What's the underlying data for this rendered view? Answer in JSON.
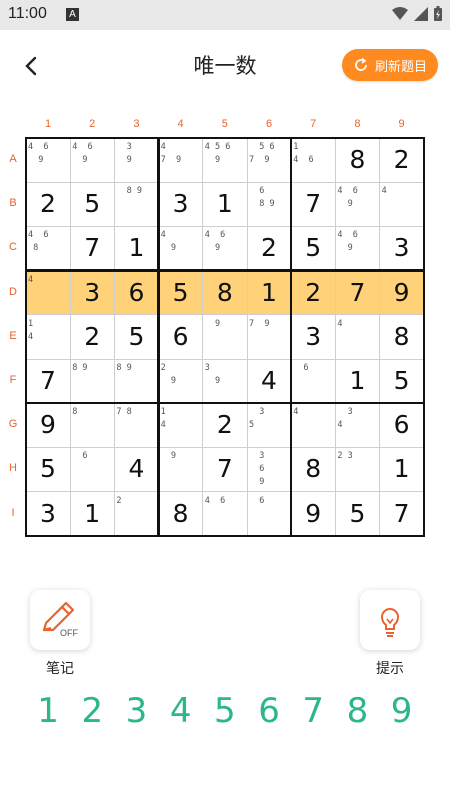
{
  "status_bar": {
    "time": "11:00",
    "notification_icon": "A"
  },
  "header": {
    "title": "唯一数",
    "refresh_label": "刷新题目"
  },
  "column_labels": [
    "1",
    "2",
    "3",
    "4",
    "5",
    "6",
    "7",
    "8",
    "9"
  ],
  "row_labels": [
    "A",
    "B",
    "C",
    "D",
    "E",
    "F",
    "G",
    "H",
    "I"
  ],
  "highlighted_row": 3,
  "accent_color": "#ff8a1f",
  "highlight_color": "#ffd27a",
  "number_color": "#2bb68e",
  "grid": [
    [
      {
        "n": "4  6\n  9"
      },
      {
        "n": "4  6\n  9"
      },
      {
        "n": "  3\n  9"
      },
      {
        "n": "4\n7  9"
      },
      {
        "n": "4 5 6\n  9"
      },
      {
        "n": "  5 6\n7  9"
      },
      {
        "n": "1\n4  6"
      },
      {
        "v": "8"
      },
      {
        "v": "2"
      }
    ],
    [
      {
        "v": "2"
      },
      {
        "v": "5"
      },
      {
        "n": "  8 9"
      },
      {
        "v": "3"
      },
      {
        "v": "1"
      },
      {
        "n": "  6\n  8 9"
      },
      {
        "v": "7"
      },
      {
        "n": "4  6\n  9"
      },
      {
        "n": "4"
      }
    ],
    [
      {
        "n": "4  6\n 8"
      },
      {
        "v": "7"
      },
      {
        "v": "1"
      },
      {
        "n": "4\n  9"
      },
      {
        "n": "4  6\n  9"
      },
      {
        "v": "2"
      },
      {
        "v": "5"
      },
      {
        "n": "4  6\n  9"
      },
      {
        "v": "3"
      }
    ],
    [
      {
        "n": "4"
      },
      {
        "v": "3"
      },
      {
        "v": "6"
      },
      {
        "v": "5"
      },
      {
        "v": "8"
      },
      {
        "v": "1"
      },
      {
        "v": "2"
      },
      {
        "v": "7"
      },
      {
        "v": "9"
      }
    ],
    [
      {
        "n": "1\n4"
      },
      {
        "v": "2"
      },
      {
        "v": "5"
      },
      {
        "v": "6"
      },
      {
        "n": "  9"
      },
      {
        "n": "7  9"
      },
      {
        "v": "3"
      },
      {
        "n": "4"
      },
      {
        "v": "8"
      }
    ],
    [
      {
        "v": "7"
      },
      {
        "n": "8 9"
      },
      {
        "n": "8 9"
      },
      {
        "n": "2\n  9"
      },
      {
        "n": "3\n  9"
      },
      {
        "v": "4"
      },
      {
        "n": "  6"
      },
      {
        "v": "1"
      },
      {
        "v": "5"
      }
    ],
    [
      {
        "v": "9"
      },
      {
        "n": "8"
      },
      {
        "n": "7 8"
      },
      {
        "n": "1\n4"
      },
      {
        "v": "2"
      },
      {
        "n": "  3\n5"
      },
      {
        "n": "4"
      },
      {
        "n": "  3\n4"
      },
      {
        "v": "6"
      }
    ],
    [
      {
        "v": "5"
      },
      {
        "n": "  6"
      },
      {
        "v": "4"
      },
      {
        "n": "  9"
      },
      {
        "v": "7"
      },
      {
        "n": "  3\n  6\n  9"
      },
      {
        "v": "8"
      },
      {
        "n": "2 3"
      },
      {
        "v": "1"
      }
    ],
    [
      {
        "v": "3"
      },
      {
        "v": "1"
      },
      {
        "n": "2"
      },
      {
        "v": "8"
      },
      {
        "n": "4  6"
      },
      {
        "n": "  6"
      },
      {
        "v": "9"
      },
      {
        "v": "5"
      },
      {
        "v": "7"
      }
    ]
  ],
  "tools": {
    "notes_label": "笔记",
    "notes_state": "OFF",
    "hint_label": "提示"
  },
  "numpad": [
    "1",
    "2",
    "3",
    "4",
    "5",
    "6",
    "7",
    "8",
    "9"
  ]
}
